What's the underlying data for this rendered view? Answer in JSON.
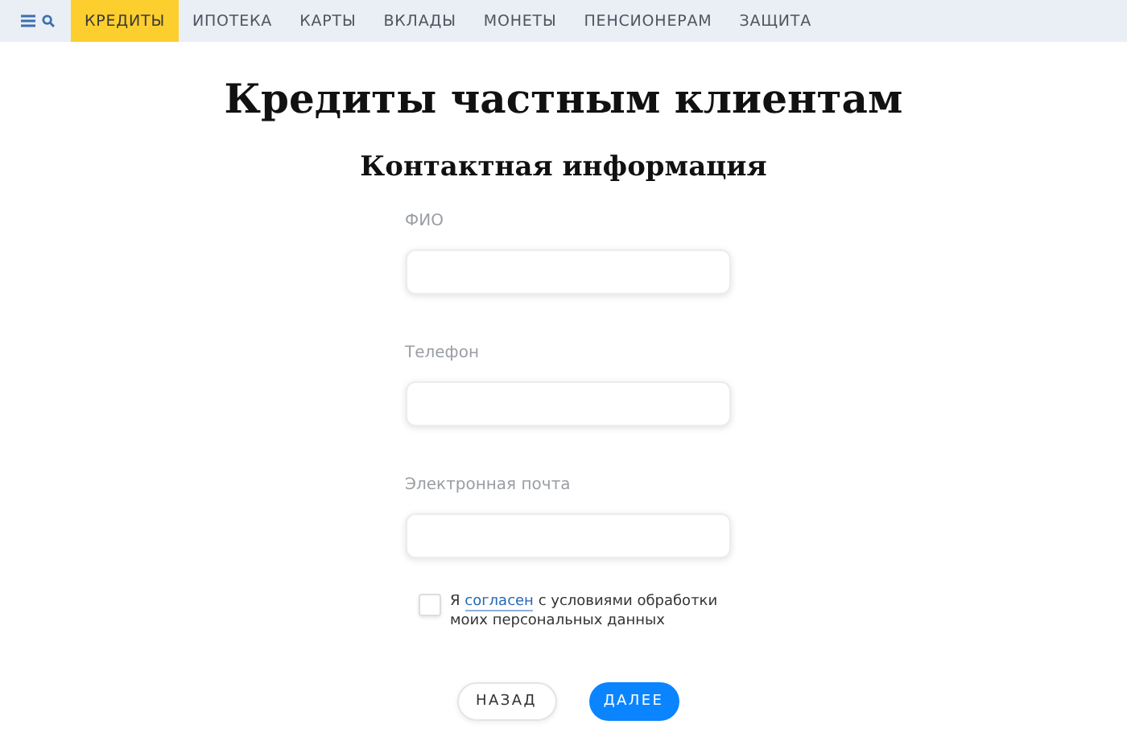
{
  "nav": {
    "items": [
      {
        "label": "КРЕДИТЫ",
        "selected": true
      },
      {
        "label": "ИПОТЕКА",
        "selected": false
      },
      {
        "label": "КАРТЫ",
        "selected": false
      },
      {
        "label": "ВКЛАДЫ",
        "selected": false
      },
      {
        "label": "МОНЕТЫ",
        "selected": false
      },
      {
        "label": "ПЕНСИОНЕРАМ",
        "selected": false
      },
      {
        "label": "ЗАЩИТА",
        "selected": false
      }
    ]
  },
  "title": "Кредиты частным клиентам",
  "form": {
    "heading": "Контактная информация",
    "fields": [
      {
        "label": "ФИО"
      },
      {
        "label": "Телефон"
      },
      {
        "label": "Электронная почта"
      }
    ],
    "consent": {
      "checked": false,
      "before": "Я",
      "link": "согласен",
      "after": "с условиями обработки моих персональных данных"
    },
    "buttons": [
      {
        "label": "НАЗАД",
        "kind": "secondary"
      },
      {
        "label": "ДАЛЕЕ",
        "kind": "primary"
      }
    ]
  }
}
